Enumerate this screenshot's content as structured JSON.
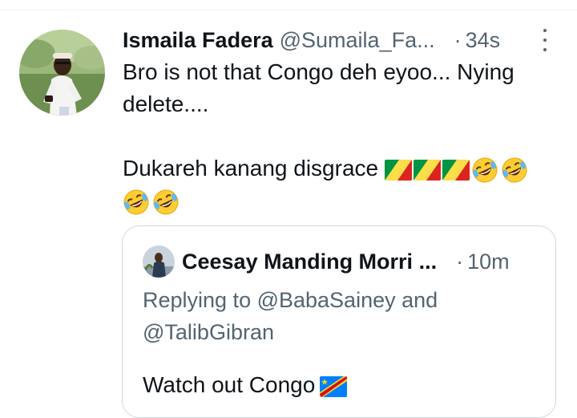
{
  "tweet": {
    "author_name": "Ismaila Fadera",
    "author_handle": "@Sumaila_Fa...",
    "time_separator": "·",
    "time": "34s",
    "text_line1": "Bro is not that Congo deh eyoo... Nying",
    "text_line2": "delete....",
    "text_line3": "Dukareh kanang disgrace",
    "text_emojis": [
      "flag-congo-icon",
      "flag-congo-icon",
      "flag-congo-icon",
      "rolling-laughing-icon",
      "rolling-laughing-icon",
      "rolling-laughing-icon",
      "rolling-laughing-icon"
    ],
    "more_icon": "more-vertical-icon"
  },
  "quoted_tweet": {
    "author_name": "Ceesay Manding Morri ...",
    "time_separator": "·",
    "time": "10m",
    "reply_line1": "Replying to @BabaSainey and",
    "reply_line2": "@TalibGibran",
    "text": "Watch out Congo",
    "text_emoji": "flag-dr-congo-icon"
  },
  "colors": {
    "text_primary": "#0f1419",
    "text_secondary": "#536471",
    "border": "#cfd9de",
    "divider": "#eff3f4"
  }
}
